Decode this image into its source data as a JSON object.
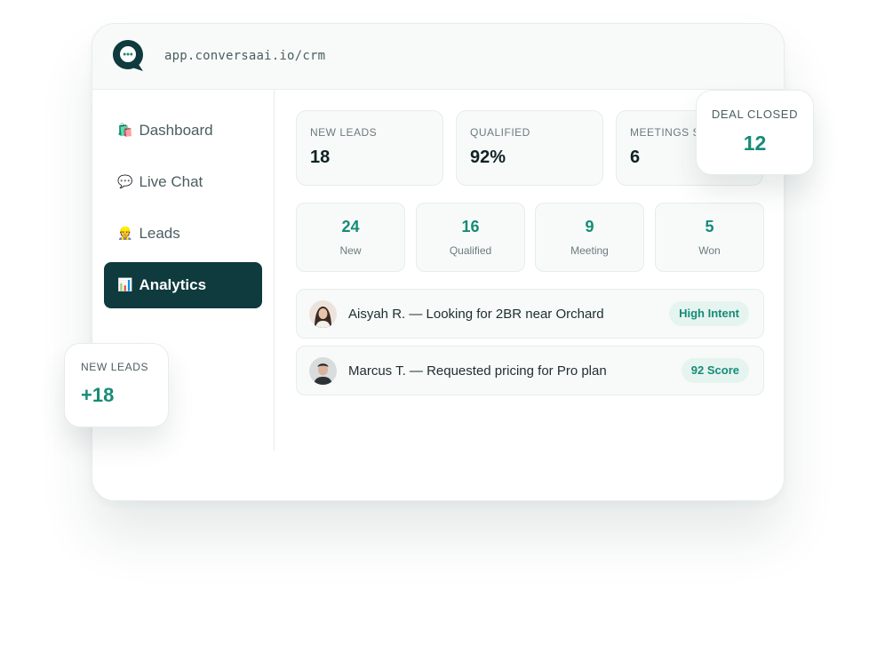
{
  "browser": {
    "url": "app.conversaai.io/crm"
  },
  "sidebar": {
    "items": [
      {
        "emoji": "🛍️",
        "label": "Dashboard",
        "active": false
      },
      {
        "emoji": "💬",
        "label": "Live Chat",
        "active": false
      },
      {
        "emoji": "👷",
        "label": "Leads",
        "active": false
      },
      {
        "emoji": "📊",
        "label": "Analytics",
        "active": true
      }
    ]
  },
  "stats": [
    {
      "label": "NEW LEADS",
      "value": "18"
    },
    {
      "label": "QUALIFIED",
      "value": "92%"
    },
    {
      "label": "MEETINGS SET",
      "value": "6"
    }
  ],
  "pipeline": [
    {
      "count": "24",
      "label": "New"
    },
    {
      "count": "16",
      "label": "Qualified"
    },
    {
      "count": "9",
      "label": "Meeting"
    },
    {
      "count": "5",
      "label": "Won"
    }
  ],
  "leads": [
    {
      "text": "Aisyah R. — Looking for 2BR near Orchard",
      "tag": "High Intent"
    },
    {
      "text": "Marcus T. — Requested pricing for Pro plan",
      "tag": "92 Score"
    }
  ],
  "floating": {
    "deal_closed": {
      "label": "DEAL CLOSED",
      "value": "12"
    },
    "new_leads": {
      "label": "NEW LEADS",
      "value": "+18"
    }
  },
  "colors": {
    "brand_dark": "#0f3a3e",
    "accent": "#168b78",
    "tag_bg": "#e6f4f0"
  },
  "icons": {
    "logo": "chat-bubble-icon"
  }
}
